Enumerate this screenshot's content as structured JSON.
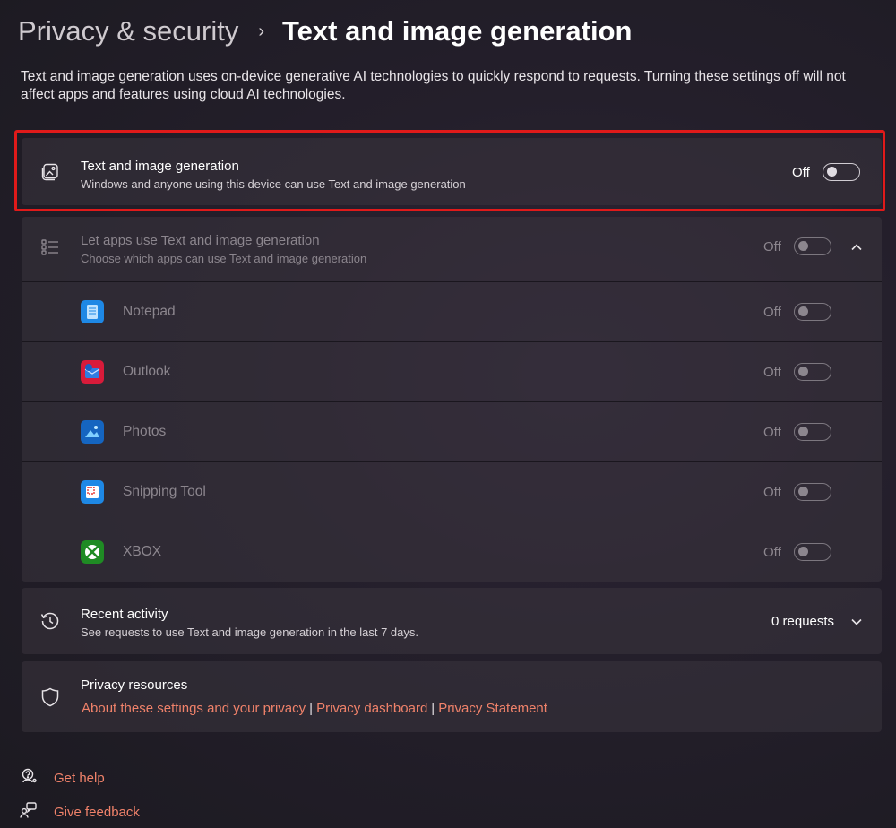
{
  "header": {
    "parent": "Privacy & security",
    "separator": "›",
    "current": "Text and image generation"
  },
  "description": "Text and image generation uses on-device generative AI technologies to quickly respond to requests. Turning these settings off will not affect apps and features using cloud AI technologies.",
  "main_setting": {
    "title": "Text and image generation",
    "subtitle": "Windows and anyone using this device can use Text and image generation",
    "state_label": "Off",
    "icon": "image-icon"
  },
  "apps_setting": {
    "title": "Let apps use Text and image generation",
    "subtitle": "Choose which apps can use Text and image generation",
    "state_label": "Off",
    "icon": "list-icon",
    "apps": [
      {
        "name": "Notepad",
        "state_label": "Off",
        "color": "#1e88e5"
      },
      {
        "name": "Outlook",
        "state_label": "Off",
        "color": "#d81b3a"
      },
      {
        "name": "Photos",
        "state_label": "Off",
        "color": "#1565c0"
      },
      {
        "name": "Snipping Tool",
        "state_label": "Off",
        "color": "#1e88e5"
      },
      {
        "name": "XBOX",
        "state_label": "Off",
        "color": "#1f8b24"
      }
    ]
  },
  "recent_activity": {
    "title": "Recent activity",
    "subtitle": "See requests to use Text and image generation in the last 7 days.",
    "value": "0 requests",
    "icon": "history-icon"
  },
  "privacy_resources": {
    "title": "Privacy resources",
    "icon": "shield-icon",
    "links": [
      "About these settings and your privacy",
      "Privacy dashboard",
      "Privacy Statement"
    ],
    "separator": "|"
  },
  "footer": {
    "get_help": "Get help",
    "give_feedback": "Give feedback"
  },
  "colors": {
    "accent_link": "#f0826a",
    "highlight": "#e01a1a"
  }
}
